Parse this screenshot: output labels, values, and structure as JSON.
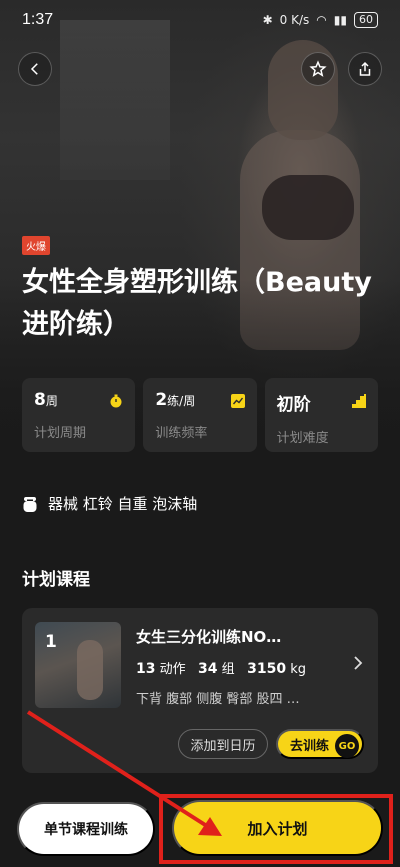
{
  "status_bar": {
    "time": "1:37",
    "net_speed": "0 K/s",
    "battery": "60"
  },
  "header": {
    "back_icon": "chevron-left-icon",
    "favorite_icon": "star-icon",
    "share_icon": "share-icon"
  },
  "plan": {
    "badge": "火爆",
    "title": "女性全身塑形训练（Beauty进阶练）",
    "stats": [
      {
        "value": "8",
        "unit": "周",
        "label": "计划周期",
        "icon": "stopwatch-icon"
      },
      {
        "value": "2",
        "unit": "练/周",
        "label": "训练频率",
        "icon": "trend-chart-icon"
      },
      {
        "value": "初阶",
        "unit": "",
        "label": "计划难度",
        "icon": "level-bars-icon"
      }
    ],
    "equipment": "器械 杠铃 自重 泡沫轴"
  },
  "courses_section": {
    "title": "计划课程",
    "items": [
      {
        "number": "1",
        "name": "女生三分化训练NO…",
        "actions_count": "13",
        "actions_unit": "动作",
        "sets_count": "34",
        "sets_unit": "组",
        "weight": "3150",
        "weight_unit": "kg",
        "tags": "下背 腹部 侧腹 臀部 股四 …",
        "add_calendar_label": "添加到日历",
        "train_label": "去训练",
        "go_label": "GO"
      }
    ]
  },
  "bottom_bar": {
    "single_label": "单节课程训练",
    "join_label": "加入计划"
  },
  "colors": {
    "accent": "#f7d417",
    "background": "#1a1a1a",
    "card": "#2b2b2b",
    "badge": "#e0452e",
    "annotation": "#e0211b"
  }
}
